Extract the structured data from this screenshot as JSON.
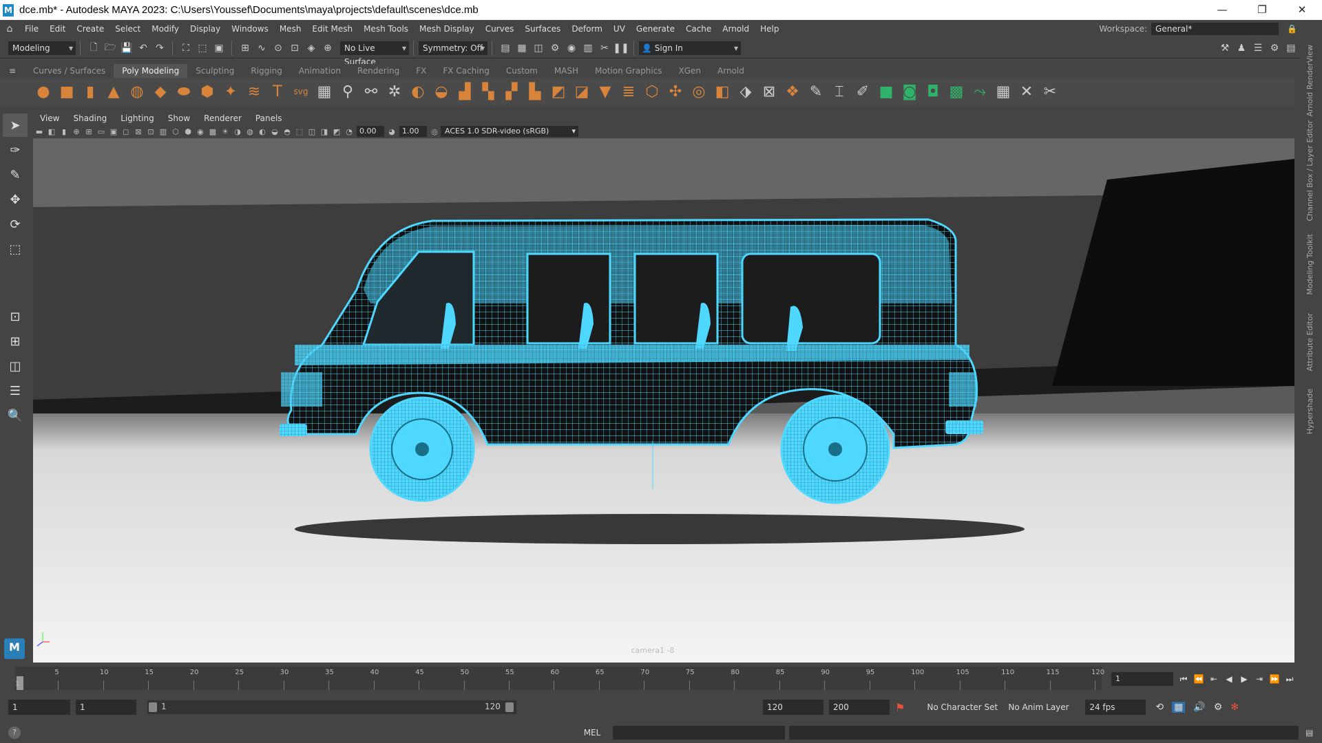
{
  "window": {
    "title": "dce.mb* - Autodesk MAYA 2023: C:\\Users\\Youssef\\Documents\\maya\\projects\\default\\scenes\\dce.mb",
    "app_icon": "M",
    "minimize": "—",
    "maximize": "❐",
    "close": "✕"
  },
  "menu": {
    "items": [
      "File",
      "Edit",
      "Create",
      "Select",
      "Modify",
      "Display",
      "Windows",
      "Mesh",
      "Edit Mesh",
      "Mesh Tools",
      "Mesh Display",
      "Curves",
      "Surfaces",
      "Deform",
      "UV",
      "Generate",
      "Cache",
      "Arnold",
      "Help"
    ],
    "workspace_label": "Workspace:",
    "workspace_value": "General*"
  },
  "status_line": {
    "menuset": "Modeling",
    "live_surface": "No Live Surface",
    "symmetry": "Symmetry: Off",
    "sign_in": "Sign In"
  },
  "shelf": {
    "tabs": [
      "Curves / Surfaces",
      "Poly Modeling",
      "Sculpting",
      "Rigging",
      "Animation",
      "Rendering",
      "FX",
      "FX Caching",
      "Custom",
      "MASH",
      "Motion Graphics",
      "XGen",
      "Arnold"
    ],
    "active_tab": "Poly Modeling"
  },
  "panel": {
    "menus": [
      "View",
      "Shading",
      "Lighting",
      "Show",
      "Renderer",
      "Panels"
    ],
    "exposure": "0.00",
    "gamma": "1.00",
    "color_management": "ACES 1.0 SDR-video (sRGB)",
    "camera_label": "camera1 -8"
  },
  "right_tabs": [
    "Arnold RenderView",
    "Channel Box / Layer Editor",
    "Modeling Toolkit",
    "Attribute Editor",
    "Hypershade"
  ],
  "time_slider": {
    "current_frame": "1",
    "ticks": [
      5,
      10,
      15,
      20,
      25,
      30,
      35,
      40,
      45,
      50,
      55,
      60,
      65,
      70,
      75,
      80,
      85,
      90,
      95,
      100,
      105,
      110,
      115,
      120
    ],
    "start_tick": "1"
  },
  "range": {
    "start": "1",
    "playback_start": "1",
    "range_start_label": "1",
    "range_end_label": "120",
    "playback_end": "120",
    "end": "200",
    "character_set": "No Character Set",
    "anim_layer": "No Anim Layer",
    "fps": "24 fps"
  },
  "command_line": {
    "language": "MEL",
    "help_icon": "?"
  },
  "colors": {
    "wireframe": "#4fd8ff",
    "background": "#444444",
    "shelf_orange": "#d9843b",
    "shelf_green": "#2fb36a"
  }
}
